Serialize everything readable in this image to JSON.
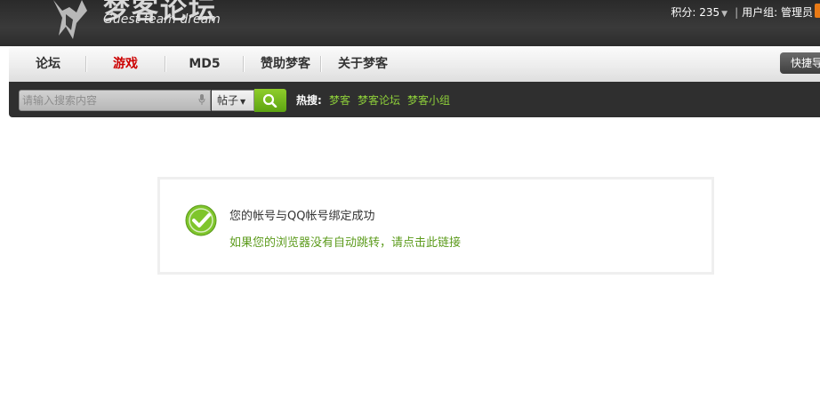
{
  "header": {
    "logo_title": "梦客论坛",
    "logo_subtitle": "Guest team dream",
    "points_label": "积分: 235",
    "usergroup_label": "用户组: 管理员"
  },
  "nav": {
    "items": [
      {
        "label": "论坛",
        "active": false
      },
      {
        "label": "游戏",
        "active": true
      },
      {
        "label": "MD5",
        "active": false
      },
      {
        "label": "赞助梦客",
        "active": false
      },
      {
        "label": "关于梦客",
        "active": false
      }
    ],
    "quick_button": "快捷导航",
    "active_color": "#cc0000"
  },
  "search": {
    "placeholder": "请输入搜索内容",
    "scope": "帖子",
    "hot_label": "热搜:",
    "hot_links": [
      "梦客",
      "梦客论坛",
      "梦客小组"
    ],
    "button_color": "#6db51a"
  },
  "message": {
    "text": "您的帐号与QQ帐号绑定成功",
    "link": "如果您的浏览器没有自动跳转，请点击此链接",
    "link_color": "#5c9b1c",
    "icon": "check-circle-icon"
  }
}
